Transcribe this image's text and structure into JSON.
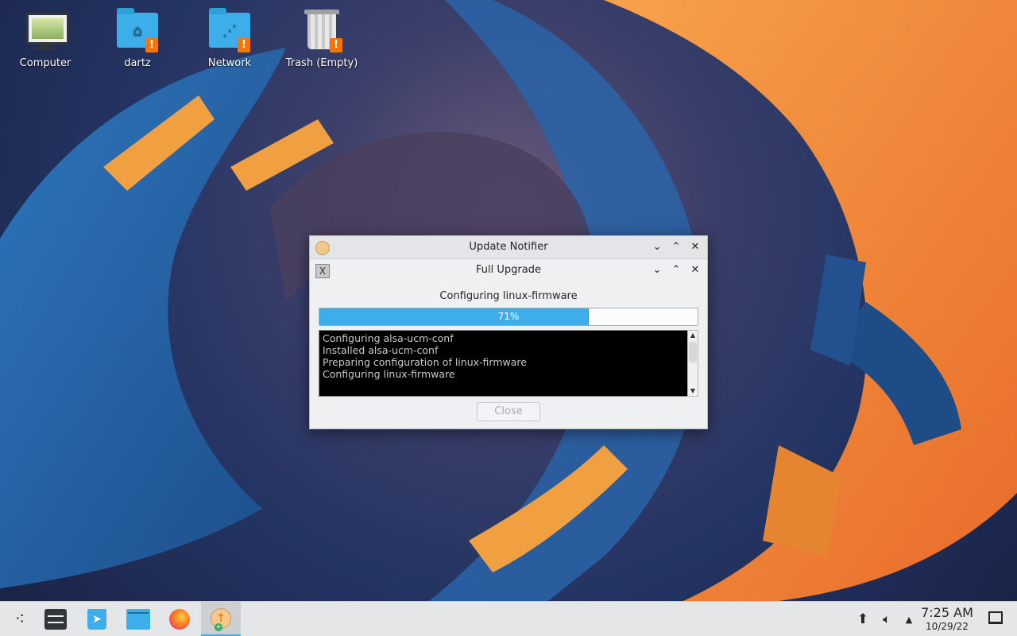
{
  "desktop": {
    "icons": [
      {
        "label": "Computer",
        "icon": "computer-icon"
      },
      {
        "label": "dartz",
        "icon": "home-folder-icon",
        "badge": "!"
      },
      {
        "label": "Network",
        "icon": "network-folder-icon",
        "badge": "!"
      },
      {
        "label": "Trash (Empty)",
        "icon": "trash-icon",
        "badge": "!"
      }
    ]
  },
  "update_notifier": {
    "title": "Update Notifier",
    "buttons": {
      "minimize": "⌄",
      "maximize": "⌃",
      "close": "✕"
    },
    "full_upgrade": {
      "title": "Full Upgrade",
      "status": "Configuring linux-firmware",
      "progress": {
        "value": 71,
        "label": "71%"
      },
      "log_lines": [
        "Configuring alsa-ucm-conf",
        "Installed alsa-ucm-conf",
        "Preparing configuration of linux-firmware",
        "Configuring linux-firmware"
      ],
      "close_label": "Close"
    }
  },
  "taskbar": {
    "apps": [
      {
        "name": "application-launcher",
        "icon": "launcher-icon"
      },
      {
        "name": "system-settings",
        "icon": "settings-icon"
      },
      {
        "name": "discover",
        "icon": "discover-icon"
      },
      {
        "name": "dolphin",
        "icon": "file-manager-icon"
      },
      {
        "name": "firefox",
        "icon": "firefox-icon"
      },
      {
        "name": "update-notifier",
        "icon": "update-notifier-icon",
        "active": true
      }
    ],
    "tray": {
      "icons": [
        "update-tray-icon",
        "volume-icon",
        "expand-tray-icon"
      ]
    },
    "clock": {
      "time": "7:25 AM",
      "date": "10/29/22"
    }
  },
  "colors": {
    "accent": "#3daee9",
    "warning": "#f67400",
    "panel": "#e4e6e8",
    "window": "#eff0f1"
  }
}
